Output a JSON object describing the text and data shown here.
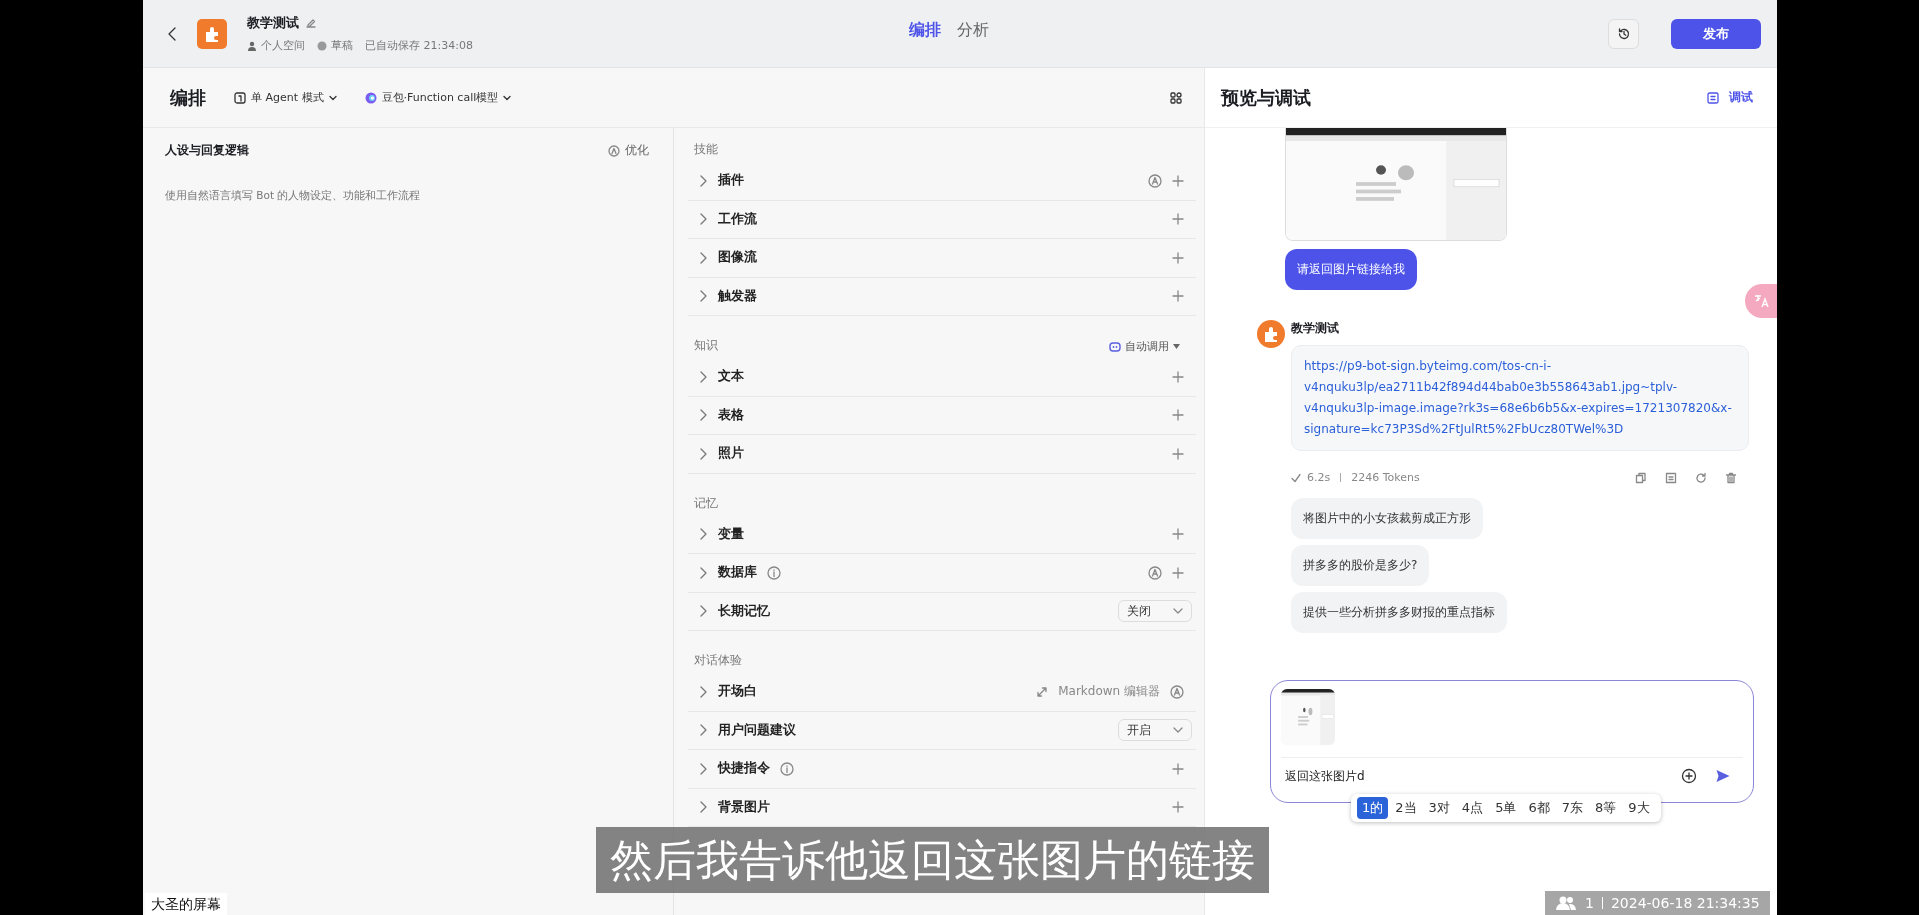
{
  "header": {
    "bot_name": "教学测试",
    "space": "个人空间",
    "status": "草稿",
    "saved": "已自动保存 21:34:08",
    "tabs": [
      {
        "label": "编排",
        "selected": true
      },
      {
        "label": "分析",
        "selected": false
      }
    ],
    "publish": "发布"
  },
  "toolbar": {
    "title": "编排",
    "mode": "单 Agent 模式",
    "model": "豆包·Function call模型"
  },
  "prompt": {
    "title": "人设与回复逻辑",
    "optimize": "优化",
    "placeholder": "使用自然语言填写 Bot 的人物设定、功能和工作流程"
  },
  "skills": [
    {
      "title": "技能",
      "items": [
        {
          "kind": "add",
          "label": "插件",
          "auto": true,
          "info": false
        },
        {
          "kind": "add",
          "label": "工作流",
          "auto": false,
          "info": false
        },
        {
          "kind": "add",
          "label": "图像流",
          "auto": false,
          "info": false
        },
        {
          "kind": "add",
          "label": "触发器",
          "auto": false,
          "info": false
        }
      ]
    },
    {
      "title": "知识",
      "mode": "自动调用",
      "items": [
        {
          "kind": "add",
          "label": "文本",
          "auto": false,
          "info": false
        },
        {
          "kind": "add",
          "label": "表格",
          "auto": false,
          "info": false
        },
        {
          "kind": "add",
          "label": "照片",
          "auto": false,
          "info": false
        }
      ]
    },
    {
      "title": "记忆",
      "items": [
        {
          "kind": "add",
          "label": "变量",
          "auto": false,
          "info": false
        },
        {
          "kind": "add",
          "label": "数据库",
          "auto": true,
          "info": true
        },
        {
          "kind": "select",
          "label": "长期记忆",
          "value": "关闭",
          "auto": false,
          "info": false
        }
      ]
    },
    {
      "title": "对话体验",
      "items": [
        {
          "kind": "editor",
          "label": "开场白",
          "editor": "Markdown 编辑器",
          "auto": true,
          "info": false
        },
        {
          "kind": "select",
          "label": "用户问题建议",
          "value": "开启",
          "auto": false,
          "info": false
        },
        {
          "kind": "add",
          "label": "快捷指令",
          "auto": false,
          "info": true
        },
        {
          "kind": "add",
          "label": "背景图片",
          "auto": false,
          "info": false
        }
      ]
    }
  ],
  "preview": {
    "title": "预览与调试",
    "debug": "调试",
    "messages": [
      {
        "kind": "picture"
      },
      {
        "kind": "user",
        "text": "请返回图片链接给我"
      },
      {
        "kind": "bot",
        "name": "教学测试",
        "text": "https://p9-bot-sign.byteimg.com/tos-cn-i-v4nquku3lp/ea2711b42f894d44bab0e3b558643ab1.jpg~tplv-v4nquku3lp-image.image?rk3s=68e6b6b5&x-expires=1721307820&x-signature=kc73P3Sd%2FtJulRt5%2FbUcz80TWel%3D",
        "time": "6.2s",
        "tokens": "2246 Tokens"
      }
    ],
    "suggestions": [
      "将图片中的小女孩裁剪成正方形",
      "拼多多的股价是多少?",
      "提供一些分析拼多多财报的重点指标"
    ],
    "input": {
      "value": "返回这张图片d"
    },
    "ime": [
      {
        "label": "1的",
        "selected": true
      },
      {
        "label": "2当",
        "selected": false
      },
      {
        "label": "3对",
        "selected": false
      },
      {
        "label": "4点",
        "selected": false
      },
      {
        "label": "5单",
        "selected": false
      },
      {
        "label": "6都",
        "selected": false
      },
      {
        "label": "7东",
        "selected": false
      },
      {
        "label": "8等",
        "selected": false
      },
      {
        "label": "9大",
        "selected": false
      }
    ]
  },
  "overlay": {
    "subtitle": "然后我告诉他返回这张图片的链接",
    "screen_label": "大圣的屏幕",
    "participants": "1",
    "timestamp": "2024-06-18 21:34:35"
  }
}
